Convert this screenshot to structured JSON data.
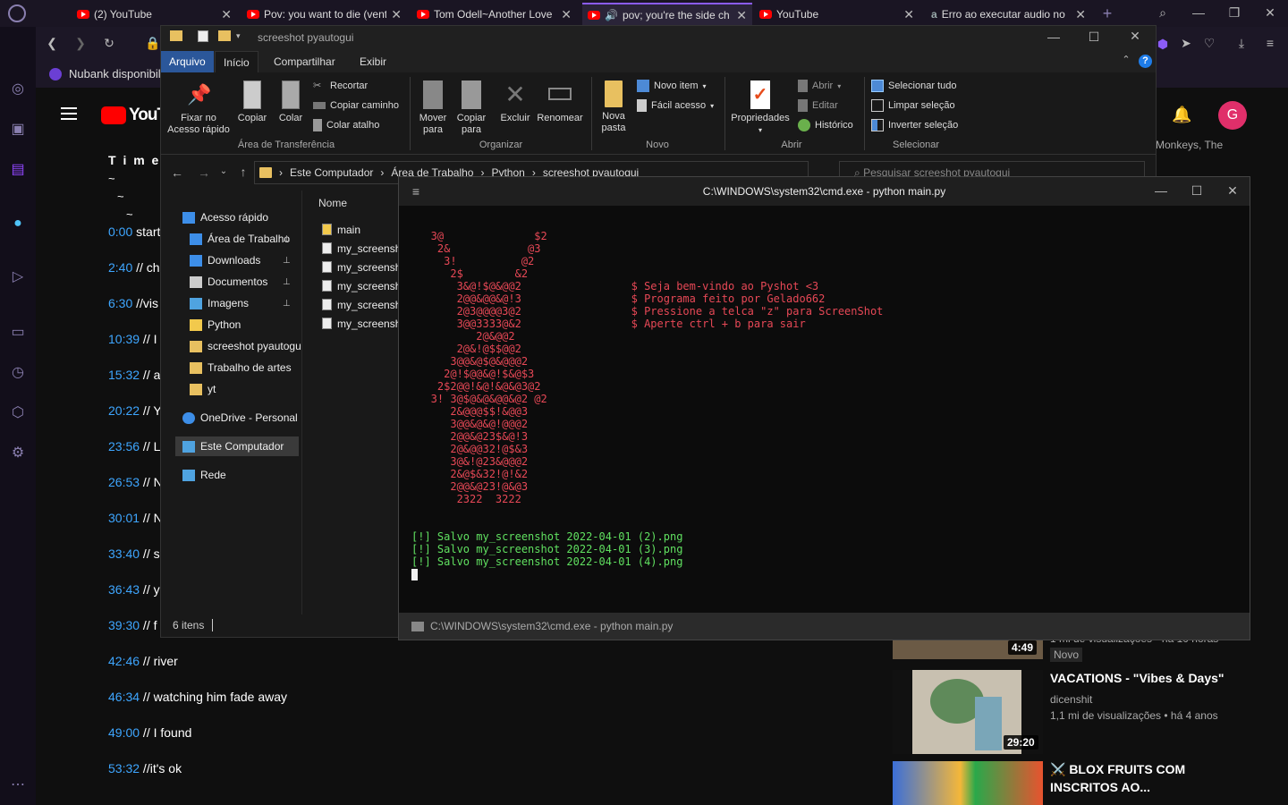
{
  "browser": {
    "tabs": [
      {
        "label": "(2) YouTube",
        "active": false
      },
      {
        "label": "Pov: you want to die (vent",
        "active": false
      },
      {
        "label": "Tom Odell~Another Love",
        "active": false
      },
      {
        "label": "pov; you're the side ch",
        "active": true
      },
      {
        "label": "YouTube",
        "active": false
      },
      {
        "label": "Erro ao executar audio no",
        "active": false
      }
    ],
    "bookmark": "Nubank disponibili"
  },
  "youtube": {
    "logo": "YouTube",
    "avatar_letter": "G",
    "channel_partial": "Monkeys, The",
    "ascii_title": "T i m e s t",
    "timestamps": [
      {
        "time": "0:00",
        "text": " start"
      },
      {
        "time": "2:40",
        "text": " // ch"
      },
      {
        "time": "6:30",
        "text": " //vis"
      },
      {
        "time": "10:39",
        "text": " // I"
      },
      {
        "time": "15:32",
        "text": " // a"
      },
      {
        "time": "20:22",
        "text": " // Y"
      },
      {
        "time": "23:56",
        "text": " // L"
      },
      {
        "time": "26:53",
        "text": " // N"
      },
      {
        "time": "30:01",
        "text": " // N"
      },
      {
        "time": "33:40",
        "text": " // s"
      },
      {
        "time": "36:43",
        "text": " // y"
      },
      {
        "time": "39:30",
        "text": " // f"
      },
      {
        "time": "42:46",
        "text": " // river"
      },
      {
        "time": "46:34",
        "text": " // watching him fade away"
      },
      {
        "time": "49:00",
        "text": " // I found"
      },
      {
        "time": "53:32",
        "text": " //it's ok"
      }
    ],
    "videos": [
      {
        "duration": "4:49",
        "badge": "Novo",
        "meta": "1 mi de visualizações • há 10 horas"
      },
      {
        "title": "VACATIONS - \"Vibes & Days\"",
        "channel": "dicenshit",
        "meta": "1,1 mi de visualizações • há 4 anos",
        "duration": "29:20"
      },
      {
        "title": "⚔️ BLOX FRUITS COM",
        "title2": "INSCRITOS AO..."
      }
    ]
  },
  "explorer": {
    "title": "screeshot pyautogui",
    "menu": [
      "Arquivo",
      "Início",
      "Compartilhar",
      "Exibir"
    ],
    "ribbon": {
      "pin": "Fixar no\nAcesso rápido",
      "copy": "Copiar",
      "paste": "Colar",
      "cut": "Recortar",
      "copy_path": "Copiar caminho",
      "paste_shortcut": "Colar atalho",
      "group_clipboard": "Área de Transferência",
      "move_to": "Mover\npara",
      "copy_to": "Copiar\npara",
      "delete": "Excluir",
      "rename": "Renomear",
      "group_organize": "Organizar",
      "new_folder": "Nova\npasta",
      "new_item": "Novo item",
      "easy_access": "Fácil acesso",
      "group_new": "Novo",
      "properties": "Propriedades",
      "open": "Abrir",
      "edit": "Editar",
      "history": "Histórico",
      "group_open": "Abrir",
      "select_all": "Selecionar tudo",
      "clear_selection": "Limpar seleção",
      "invert_selection": "Inverter seleção",
      "group_select": "Selecionar"
    },
    "breadcrumb": [
      "Este Computador",
      "Área de Trabalho",
      "Python",
      "screeshot pyautogui"
    ],
    "search_placeholder": "Pesquisar screeshot pyautogui",
    "nav": [
      {
        "label": "Acesso rápido",
        "icon": "star-icon"
      },
      {
        "label": "Área de Trabalho",
        "icon": "desktop-icon"
      },
      {
        "label": "Downloads",
        "icon": "download-icon"
      },
      {
        "label": "Documentos",
        "icon": "document-icon"
      },
      {
        "label": "Imagens",
        "icon": "image-icon"
      },
      {
        "label": "Python",
        "icon": "python-icon"
      },
      {
        "label": "screeshot pyautogu",
        "icon": "folder-icon"
      },
      {
        "label": "Trabalho de artes",
        "icon": "folder-icon"
      },
      {
        "label": "yt",
        "icon": "folder-icon"
      },
      {
        "label": "OneDrive - Personal",
        "icon": "cloud-icon"
      },
      {
        "label": "Este Computador",
        "icon": "computer-icon"
      },
      {
        "label": "Rede",
        "icon": "network-icon"
      }
    ],
    "column_name": "Nome",
    "files": [
      "main",
      "my_screensh",
      "my_screensh",
      "my_screensh",
      "my_screensh",
      "my_screensh"
    ],
    "status": "6 itens"
  },
  "cmd": {
    "title": "C:\\WINDOWS\\system32\\cmd.exe - python main.py",
    "footer": "C:\\WINDOWS\\system32\\cmd.exe - python main.py",
    "art": [
      "   3@              $2",
      "    2&            @3",
      "     3!          @2",
      "      2$        &2",
      "       3&@!$@&@@2                 $ Seja bem-vindo ao Pyshot <3",
      "       2@@&@@&@!3                 $ Programa feito por Gelado662",
      "       2@3@@@@3@2                 $ Pressione a telca \"z\" para ScreenShot",
      "       3@@3333@&2                 $ Aperte ctrl + b para sair",
      "          2@&@@2",
      "       2@&!@$$@@2",
      "      3@@&@$@&@@@2",
      "     2@!$@@&@!$&@$3",
      "    2$2@@!&@!&@&@3@2",
      "   3! 3@$@&@&@@&@2 @2",
      "      2&@@@$$!&@@3",
      "      3@@&@&@!@@@2",
      "      2@@&@23$&@!3",
      "      2@&@@32!@$&3",
      "      3@&!@23&@@@2",
      "      2&@$&32!@!&2",
      "      2@@&@23!@&@3",
      "       2322  3222"
    ],
    "saved": [
      "[!] Salvo my_screenshot 2022-04-01 (2).png",
      "[!] Salvo my_screenshot 2022-04-01 (3).png",
      "[!] Salvo my_screenshot 2022-04-01 (4).png"
    ],
    "colors": {
      "art": "#e74856",
      "saved": "#60e060"
    }
  }
}
